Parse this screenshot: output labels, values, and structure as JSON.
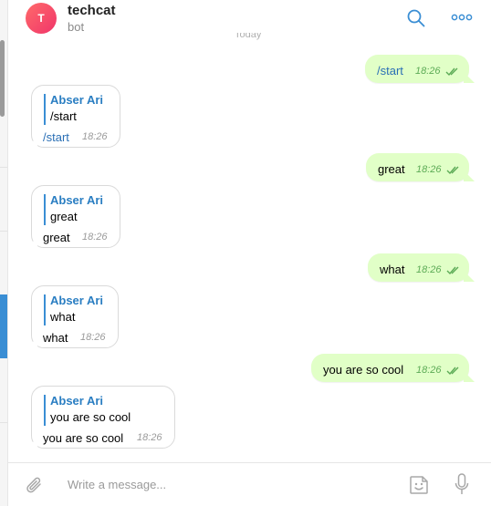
{
  "header": {
    "avatar_letter": "T",
    "title": "techcat",
    "subtitle": "bot",
    "date_separator": "Today"
  },
  "icons": {
    "search": "search-icon",
    "more": "more-icon",
    "attach": "paperclip-icon",
    "sticker": "sticker-icon",
    "mic": "microphone-icon",
    "read_status": "double-check-icon"
  },
  "colors": {
    "outgoing_bubble": "#e1ffc7",
    "accent": "#3a8ed4",
    "avatar_gradient_start": "#ff6a6a",
    "avatar_gradient_end": "#f0356a"
  },
  "messages": [
    {
      "direction": "out",
      "text": "/start",
      "time": "18:26"
    },
    {
      "direction": "in",
      "quote_author": "Abser Ari",
      "quote_text": "/start",
      "text": "/start",
      "time": "18:26"
    },
    {
      "direction": "out",
      "text": "great",
      "time": "18:26"
    },
    {
      "direction": "in",
      "quote_author": "Abser Ari",
      "quote_text": "great",
      "text": "great",
      "time": "18:26"
    },
    {
      "direction": "out",
      "text": "what",
      "time": "18:26"
    },
    {
      "direction": "in",
      "quote_author": "Abser Ari",
      "quote_text": "what",
      "text": "what",
      "time": "18:26"
    },
    {
      "direction": "out",
      "text": "you are so cool",
      "time": "18:26"
    },
    {
      "direction": "in",
      "quote_author": "Abser Ari",
      "quote_text": "you are so cool",
      "text": "you are so cool",
      "time": "18:26"
    }
  ],
  "composer": {
    "placeholder": "Write a message..."
  }
}
